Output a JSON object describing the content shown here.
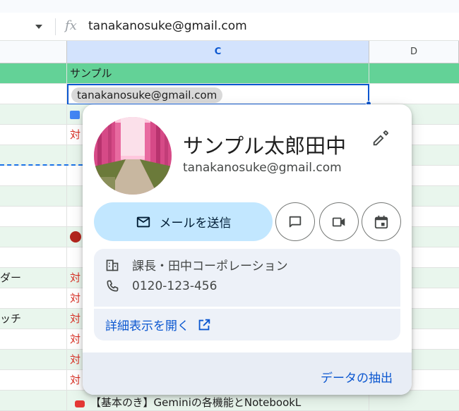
{
  "formula_bar": {
    "fx_label": "fx",
    "value": "tanakanosuke@gmail.com"
  },
  "columns": {
    "c": "C",
    "d": "D"
  },
  "sheet": {
    "header_cell": "サンプル",
    "selected_cell_chip": "tanakanosuke@gmail.com",
    "col_a_partial": [
      "ダー",
      "ッチ"
    ],
    "col_c_partial_char": "対",
    "bottom_row_text": "【基本のき】Geminiの各機能とNotebookL"
  },
  "card": {
    "name": "サンプル太郎田中",
    "email": "tanakanosuke@gmail.com",
    "send_mail_label": "メールを送信",
    "job": "課長・田中コーポレーション",
    "phone": "0120-123-456",
    "open_details": "詳細表示を開く",
    "extract_label": "データの抽出",
    "icons": [
      "edit-icon",
      "mail-icon",
      "chat-icon",
      "video-icon",
      "calendar-icon",
      "building-icon",
      "phone-icon",
      "open-external-icon"
    ]
  },
  "colors": {
    "accent": "#0b57d0",
    "mail_button_bg": "#c2e7ff",
    "header_green": "#63d297",
    "row_green": "#e9f6ed",
    "red_text": "#d93025"
  }
}
